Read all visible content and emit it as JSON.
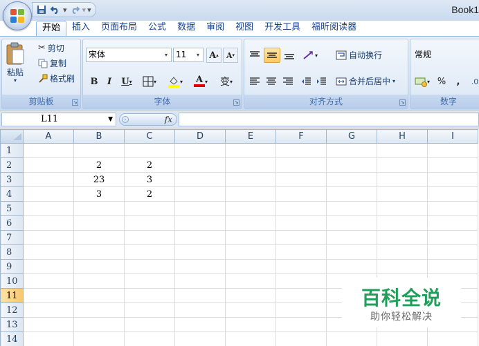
{
  "window": {
    "title": "Book1"
  },
  "qat": {
    "save_icon": "save-icon",
    "undo_icon": "undo-icon",
    "redo_icon": "redo-icon",
    "customize_glyph": "▾"
  },
  "tabs": [
    "开始",
    "插入",
    "页面布局",
    "公式",
    "数据",
    "审阅",
    "视图",
    "开发工具",
    "福昕阅读器"
  ],
  "clipboard": {
    "paste": "粘贴",
    "cut": "剪切",
    "copy": "复制",
    "format_painter": "格式刷",
    "label": "剪贴板"
  },
  "font": {
    "name": "宋体",
    "size": "11",
    "grow": "A",
    "shrink": "A",
    "bold": "B",
    "italic": "I",
    "underline": "U",
    "wen": "变",
    "font_color_letter": "A",
    "label": "字体"
  },
  "alignment": {
    "wrap": "自动换行",
    "merge": "合并后居中",
    "label": "对齐方式"
  },
  "number": {
    "format": "常规",
    "percent": "%",
    "comma": ",",
    "label": "数字"
  },
  "formula_bar": {
    "cell_ref": "L11",
    "fx": "fx",
    "value": ""
  },
  "sheet": {
    "columns": [
      "A",
      "B",
      "C",
      "D",
      "E",
      "F",
      "G",
      "H",
      "I"
    ],
    "rows": [
      {
        "num": "1",
        "cells": [
          "",
          "",
          "",
          "",
          "",
          "",
          "",
          "",
          ""
        ]
      },
      {
        "num": "2",
        "cells": [
          "",
          "2",
          "2",
          "",
          "",
          "",
          "",
          "",
          ""
        ]
      },
      {
        "num": "3",
        "cells": [
          "",
          "23",
          "3",
          "",
          "",
          "",
          "",
          "",
          ""
        ]
      },
      {
        "num": "4",
        "cells": [
          "",
          "3",
          "2",
          "",
          "",
          "",
          "",
          "",
          ""
        ]
      },
      {
        "num": "5",
        "cells": [
          "",
          "",
          "",
          "",
          "",
          "",
          "",
          "",
          ""
        ]
      },
      {
        "num": "6",
        "cells": [
          "",
          "",
          "",
          "",
          "",
          "",
          "",
          "",
          ""
        ]
      },
      {
        "num": "7",
        "cells": [
          "",
          "",
          "",
          "",
          "",
          "",
          "",
          "",
          ""
        ]
      },
      {
        "num": "8",
        "cells": [
          "",
          "",
          "",
          "",
          "",
          "",
          "",
          "",
          ""
        ]
      },
      {
        "num": "9",
        "cells": [
          "",
          "",
          "",
          "",
          "",
          "",
          "",
          "",
          ""
        ]
      },
      {
        "num": "10",
        "cells": [
          "",
          "",
          "",
          "",
          "",
          "",
          "",
          "",
          ""
        ]
      },
      {
        "num": "11",
        "cells": [
          "",
          "",
          "",
          "",
          "",
          "",
          "",
          "",
          ""
        ]
      },
      {
        "num": "12",
        "cells": [
          "",
          "",
          "",
          "",
          "",
          "",
          "",
          "",
          ""
        ]
      },
      {
        "num": "13",
        "cells": [
          "",
          "",
          "",
          "",
          "",
          "",
          "",
          "",
          ""
        ]
      },
      {
        "num": "14",
        "cells": [
          "",
          "",
          "",
          "",
          "",
          "",
          "",
          "",
          ""
        ]
      }
    ],
    "selected_row": "11"
  },
  "watermark": {
    "title": "百科全说",
    "subtitle": "助你轻松解决"
  },
  "colors": {
    "accent": "#15428b",
    "selected_header": "#f8c76d",
    "watermark_green": "#1fa05a"
  }
}
